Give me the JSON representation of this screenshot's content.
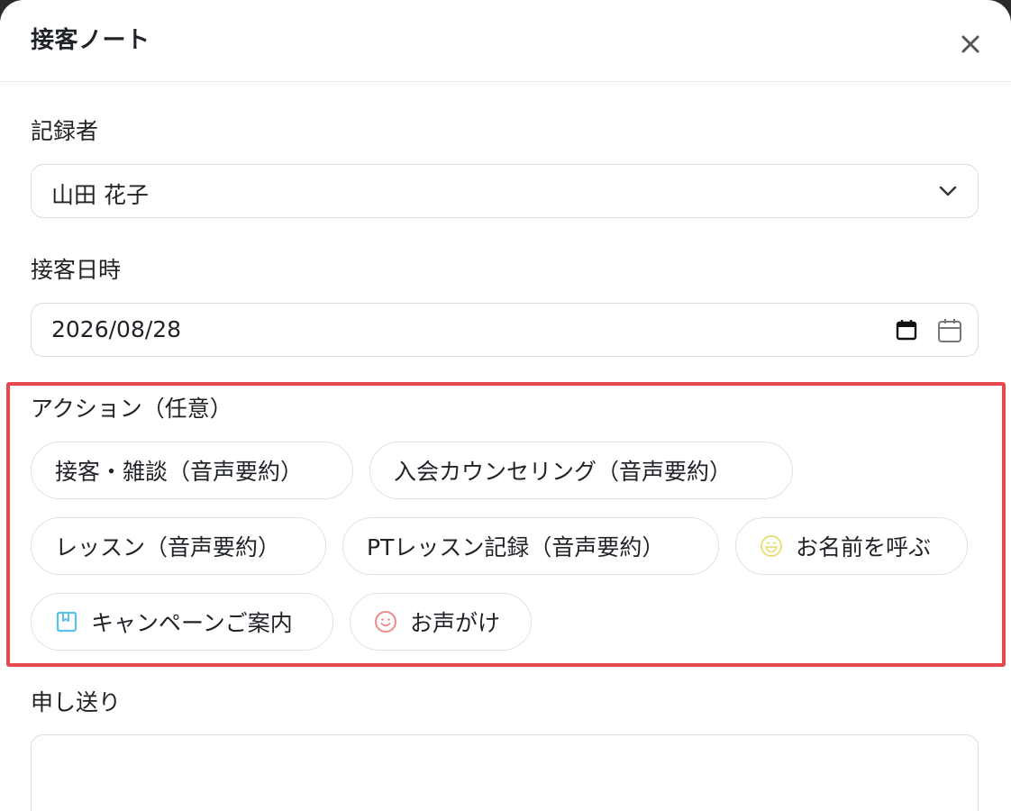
{
  "modal": {
    "title": "接客ノート"
  },
  "recorder": {
    "label": "記録者",
    "value": "山田 花子"
  },
  "datetime": {
    "label": "接客日時",
    "value": "2026/08/28"
  },
  "actions": {
    "label": "アクション（任意）",
    "chips": [
      {
        "label": "接客・雑談（音声要約）"
      },
      {
        "label": "入会カウンセリング（音声要約）"
      },
      {
        "label": "レッスン（音声要約）"
      },
      {
        "label": "PTレッスン記録（音声要約）"
      },
      {
        "label": "お名前を呼ぶ",
        "icon": "laughing-face-icon",
        "icon_color": "#e6e07a"
      },
      {
        "label": "キャンペーンご案内",
        "icon": "bookmark-box-icon",
        "icon_color": "#5bc0eb"
      },
      {
        "label": "お声がけ",
        "icon": "smiley-face-icon",
        "icon_color": "#f08a8a"
      }
    ]
  },
  "handover": {
    "label": "申し送り",
    "value": ""
  },
  "colors": {
    "highlight_border": "#e5484d",
    "field_border": "#d9dbe0"
  }
}
